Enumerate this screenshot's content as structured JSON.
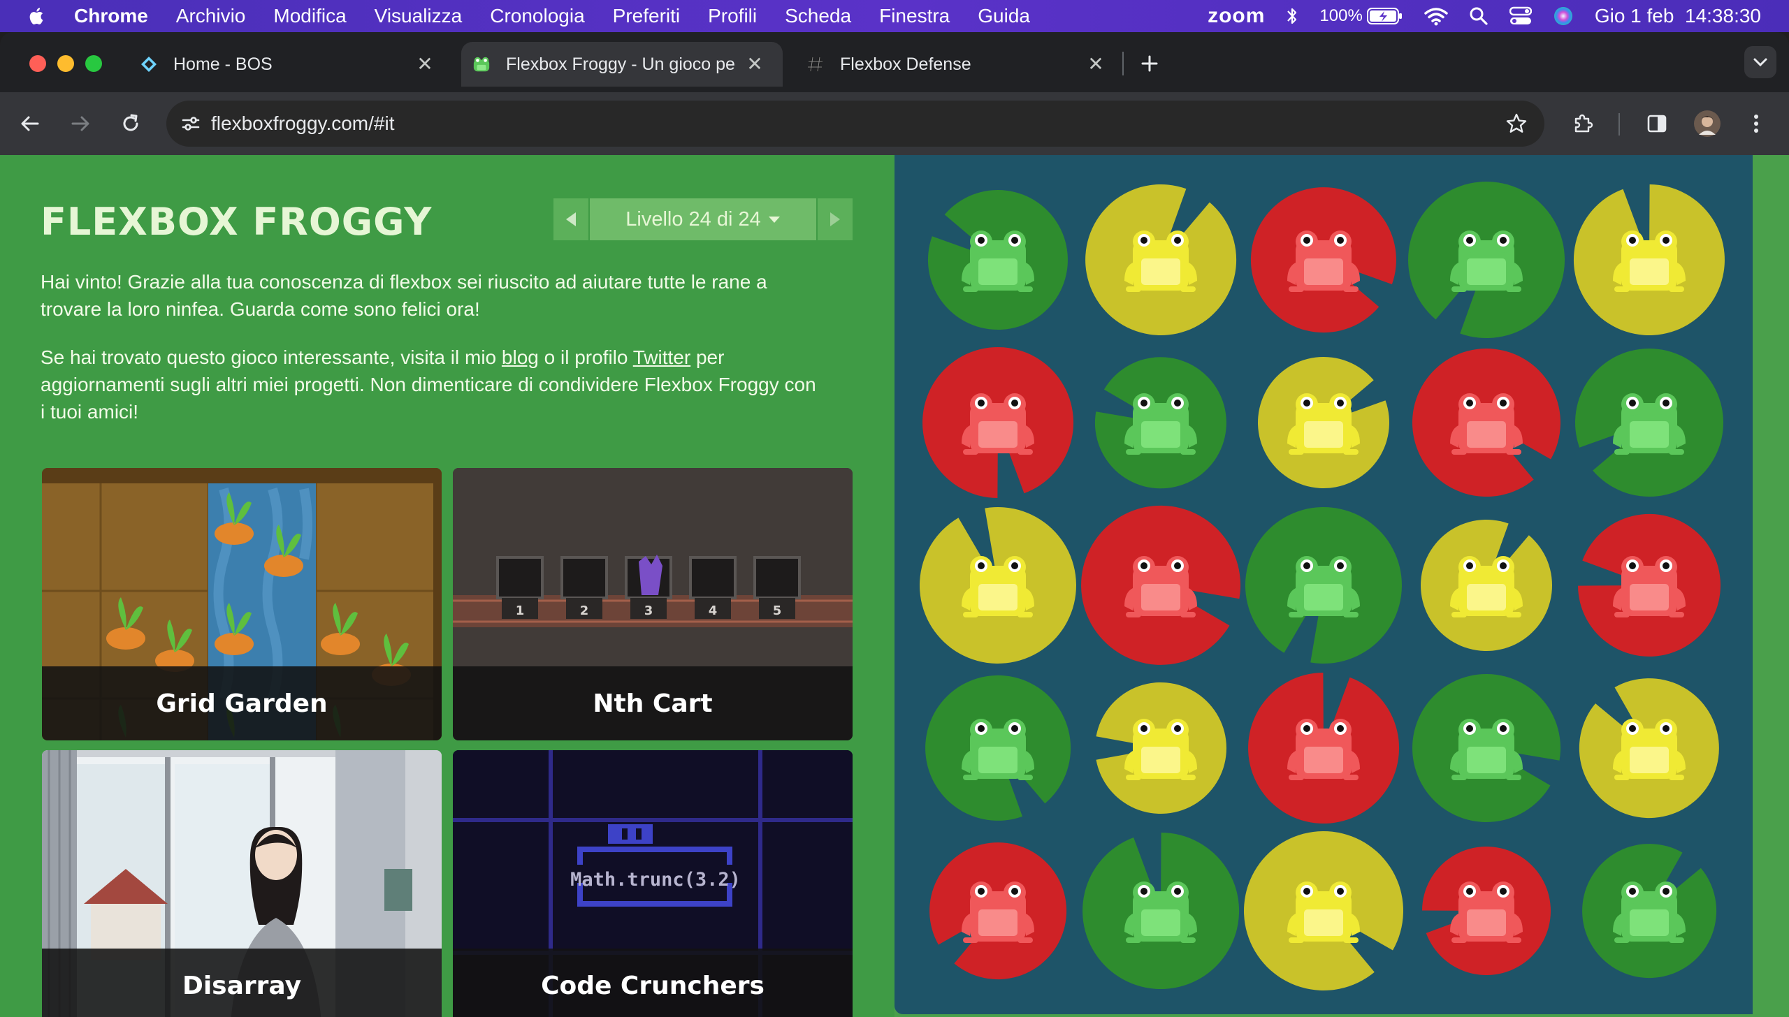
{
  "menubar": {
    "app_name": "Chrome",
    "items": [
      "Archivio",
      "Modifica",
      "Visualizza",
      "Cronologia",
      "Preferiti",
      "Profili",
      "Scheda",
      "Finestra",
      "Guida"
    ],
    "zoom": "zoom",
    "battery": "100%",
    "datetime": "Gio 1 feb  14:38:30"
  },
  "tabs": [
    {
      "title": "Home - BOS",
      "favicon": "bos-icon"
    },
    {
      "title": "Flexbox Froggy - Un gioco pe",
      "favicon": "frog-icon",
      "active": true
    },
    {
      "title": "Flexbox Defense",
      "favicon": "hash-icon"
    }
  ],
  "toolbar": {
    "url": "flexboxfroggy.com/#it"
  },
  "page": {
    "title": "FLEXBOX FROGGY",
    "level_label": "Livello 24 di 24",
    "win_text": "Hai vinto! Grazie alla tua conoscenza di flexbox sei riuscito ad aiutare tutte le rane a trovare la loro ninfea. Guarda come sono felici ora!",
    "promo_before_blog": "Se hai trovato questo gioco interessante, visita il mio ",
    "blog_link": "blog",
    "promo_between": " o il profilo ",
    "twitter_link": "Twitter",
    "promo_after": " per aggiornamenti sugli altri miei progetti. Non dimenticare di condividere Flexbox Froggy con i tuoi amici!",
    "cards": [
      {
        "title": "Grid Garden"
      },
      {
        "title": "Nth Cart",
        "cart_numbers": [
          "1",
          "2",
          "3",
          "4",
          "5"
        ]
      },
      {
        "title": "Disarray"
      },
      {
        "title": "Code Crunchers",
        "code": "Math.trunc(3.2)"
      }
    ]
  },
  "pond": {
    "rows": [
      [
        "green",
        "yellow",
        "red",
        "green",
        "yellow"
      ],
      [
        "red",
        "green",
        "yellow",
        "red",
        "green"
      ],
      [
        "yellow",
        "red",
        "green",
        "yellow",
        "red"
      ],
      [
        "green",
        "yellow",
        "red",
        "green",
        "yellow"
      ],
      [
        "red",
        "green",
        "yellow",
        "red",
        "green"
      ]
    ],
    "colors": {
      "green": {
        "pad": "#2e8c2e",
        "body": "#5bc75a",
        "belly": "#7ee27a"
      },
      "yellow": {
        "pad": "#c9c22a",
        "body": "#f0ea34",
        "belly": "#fbf68a"
      },
      "red": {
        "pad": "#cf2226",
        "body": "#f0585a",
        "belly": "#f98b8a"
      }
    }
  }
}
